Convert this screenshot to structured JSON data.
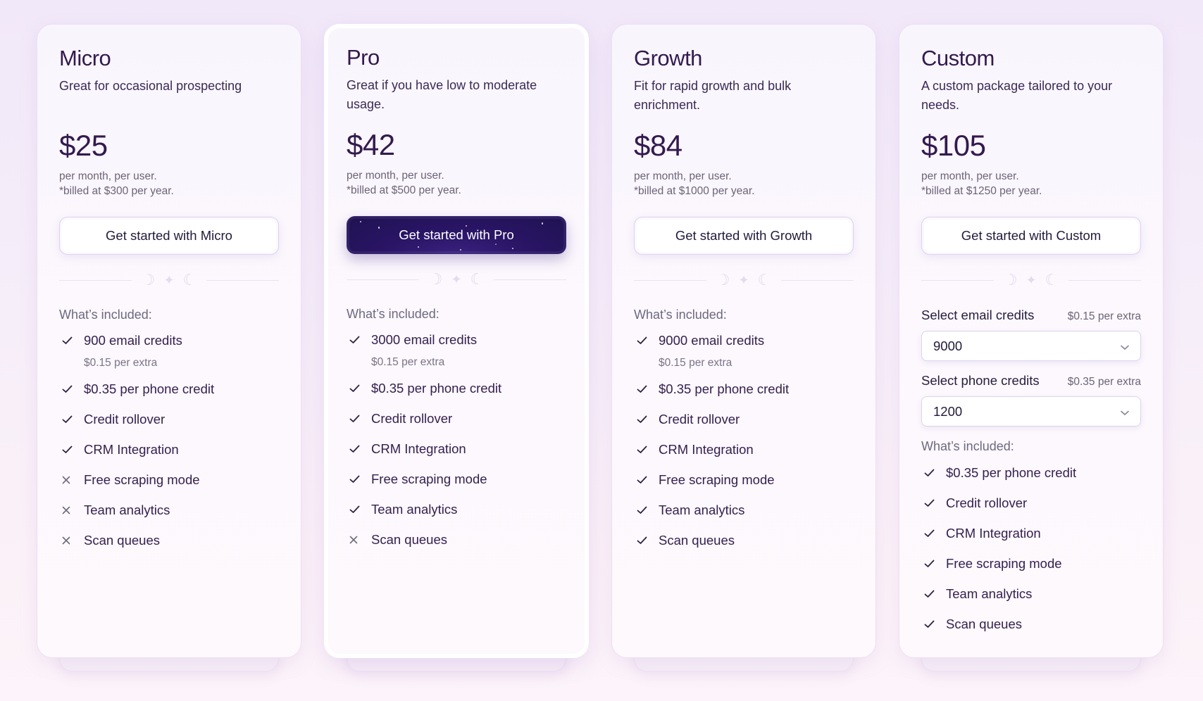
{
  "plans": [
    {
      "name": "Micro",
      "description": "Great for occasional prospecting",
      "price": "$25",
      "per": "per month, per user.",
      "billed": "*billed at $300 per year.",
      "cta": "Get started with Micro",
      "included_label": "What’s included:",
      "features": [
        {
          "text": "900 email credits",
          "sub": "$0.15 per extra",
          "included": true
        },
        {
          "text": "$0.35 per phone credit",
          "included": true
        },
        {
          "text": "Credit rollover",
          "included": true
        },
        {
          "text": "CRM Integration",
          "included": true
        },
        {
          "text": "Free scraping mode",
          "included": false
        },
        {
          "text": "Team analytics",
          "included": false
        },
        {
          "text": "Scan queues",
          "included": false
        }
      ]
    },
    {
      "name": "Pro",
      "description": "Great if you have low to moderate usage.",
      "price": "$42",
      "per": "per month, per user.",
      "billed": "*billed at $500 per year.",
      "cta": "Get started with Pro",
      "featured": true,
      "included_label": "What’s included:",
      "features": [
        {
          "text": "3000 email credits",
          "sub": "$0.15 per extra",
          "included": true
        },
        {
          "text": "$0.35 per phone credit",
          "included": true
        },
        {
          "text": "Credit rollover",
          "included": true
        },
        {
          "text": "CRM Integration",
          "included": true
        },
        {
          "text": "Free scraping mode",
          "included": true
        },
        {
          "text": "Team analytics",
          "included": true
        },
        {
          "text": "Scan queues",
          "included": false
        }
      ]
    },
    {
      "name": "Growth",
      "description": "Fit for rapid growth and bulk enrichment.",
      "price": "$84",
      "per": "per month, per user.",
      "billed": "*billed at $1000 per year.",
      "cta": "Get started with Growth",
      "included_label": "What’s included:",
      "features": [
        {
          "text": "9000 email credits",
          "sub": "$0.15 per extra",
          "included": true
        },
        {
          "text": "$0.35 per phone credit",
          "included": true
        },
        {
          "text": "Credit rollover",
          "included": true
        },
        {
          "text": "CRM Integration",
          "included": true
        },
        {
          "text": "Free scraping mode",
          "included": true
        },
        {
          "text": "Team analytics",
          "included": true
        },
        {
          "text": "Scan queues",
          "included": true
        }
      ]
    },
    {
      "name": "Custom",
      "description": "A custom package tailored to your needs.",
      "price": "$105",
      "per": "per month, per user.",
      "billed": "*billed at $1250 per year.",
      "cta": "Get started with Custom",
      "email_select": {
        "label": "Select email credits",
        "extra": "$0.15 per extra",
        "value": "9000"
      },
      "phone_select": {
        "label": "Select phone credits",
        "extra": "$0.35 per extra",
        "value": "1200"
      },
      "included_label": "What’s included:",
      "features": [
        {
          "text": "$0.35 per phone credit",
          "included": true
        },
        {
          "text": "Credit rollover",
          "included": true
        },
        {
          "text": "CRM Integration",
          "included": true
        },
        {
          "text": "Free scraping mode",
          "included": true
        },
        {
          "text": "Team analytics",
          "included": true
        },
        {
          "text": "Scan queues",
          "included": true
        }
      ]
    }
  ],
  "colors": {
    "primary_dark": "#261560",
    "heading": "#331a4e",
    "muted": "#6b6478"
  }
}
